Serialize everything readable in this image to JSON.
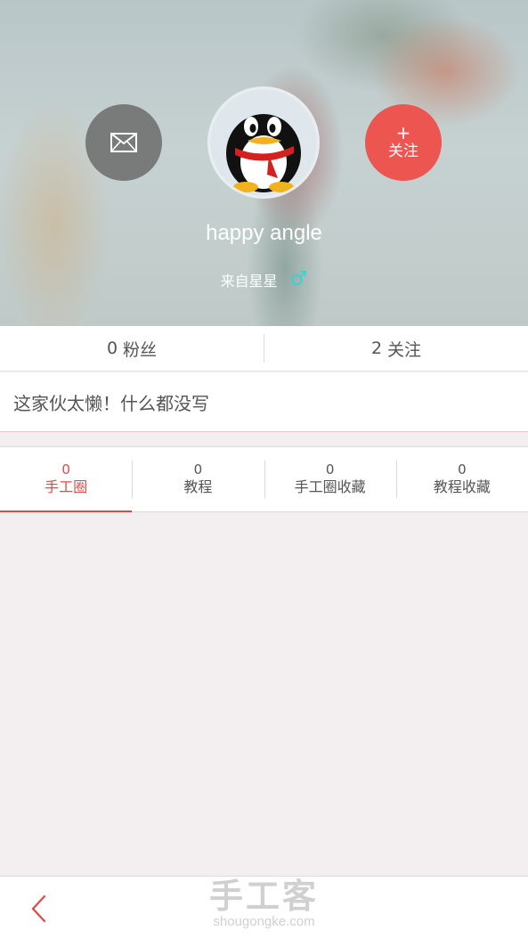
{
  "profile": {
    "username": "happy angle",
    "location": "来自星星",
    "gender_symbol": "♂",
    "follow_plus": "+",
    "follow_label": "关注"
  },
  "stats": {
    "fans_count": "0",
    "fans_label": "粉丝",
    "following_count": "2",
    "following_label": "关注"
  },
  "bio": "这家伙太懒！什么都没写",
  "tabs": [
    {
      "count": "0",
      "label": "手工圈",
      "active": true
    },
    {
      "count": "0",
      "label": "教程",
      "active": false
    },
    {
      "count": "0",
      "label": "手工圈收藏",
      "active": false
    },
    {
      "count": "0",
      "label": "教程收藏",
      "active": false
    }
  ],
  "watermark": {
    "brand": "手工客",
    "url": "shougongke.com"
  },
  "colors": {
    "accent": "#e04a46",
    "follow_button": "#ec5550",
    "gender": "#38d3d1",
    "page_background": "#f3eff0"
  },
  "icons": {
    "message": "envelope-icon",
    "back": "chevron-left-icon",
    "avatar": "penguin-avatar"
  }
}
